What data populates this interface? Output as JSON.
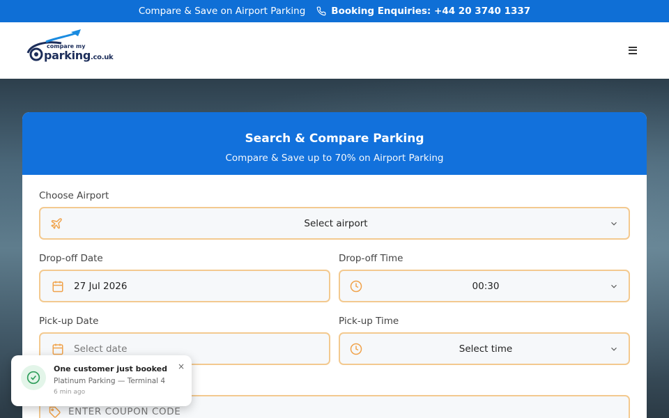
{
  "topbar": {
    "promo": "Compare & Save on Airport Parking",
    "phone_label": "Booking Enquiries: +44 20 3740 1337"
  },
  "header": {
    "logo_top": "compare my",
    "logo_main": "parking",
    "logo_suffix": ".co.uk"
  },
  "search_card": {
    "title": "Search & Compare Parking",
    "subtitle": "Compare & Save up to 70% on Airport Parking",
    "airport": {
      "label": "Choose Airport",
      "value": "Select airport"
    },
    "dropoff_date": {
      "label": "Drop-off Date",
      "value": "27 Jul 2026"
    },
    "dropoff_time": {
      "label": "Drop-off Time",
      "value": "00:30"
    },
    "pickup_date": {
      "label": "Pick-up Date",
      "placeholder": "Select date"
    },
    "pickup_time": {
      "label": "Pick-up Time",
      "value": "Select time"
    },
    "coupon": {
      "placeholder": "ENTER COUPON CODE"
    }
  },
  "toast": {
    "title": "One customer just booked",
    "detail": "Platinum Parking — Terminal 4",
    "time": "6 min ago",
    "close": "×"
  },
  "colors": {
    "brand_blue": "#1271dc",
    "field_border": "#f3c98f",
    "icon_orange": "#f0a24a"
  }
}
